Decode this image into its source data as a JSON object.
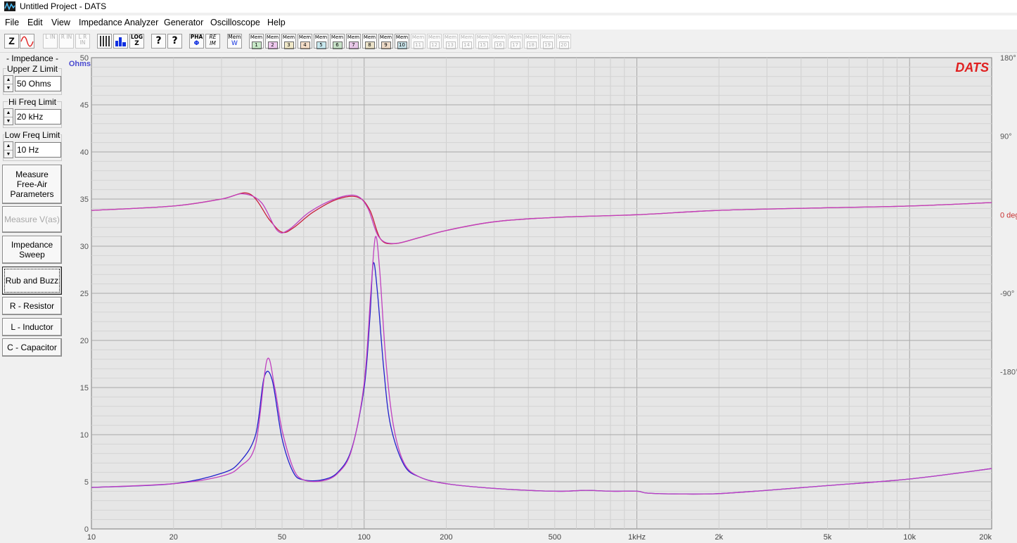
{
  "window": {
    "title": "Untitled Project - DATS"
  },
  "menu": [
    "File",
    "Edit",
    "View",
    "Impedance Analyzer",
    "Generator",
    "Oscilloscope",
    "Help"
  ],
  "toolbar": {
    "z_button": "Z",
    "wave_button": "sine-wave-icon",
    "l_in": "L IN",
    "r_in": "R IN",
    "lr_in": "L R IN",
    "log_button": "LOG",
    "log_sub": "Z",
    "help_button": "?",
    "context_help_button": "?",
    "pha_button": "PHA",
    "pha_sub": "Φ",
    "re_im_button": "RE",
    "re_im_sub": "IM",
    "mem_w_button": "Mem",
    "mem_w_sub": "W",
    "mem_label": "Mem",
    "mem_slots": [
      {
        "n": "1",
        "color": "#00a000",
        "enabled": true
      },
      {
        "n": "2",
        "color": "#c000c0",
        "enabled": true
      },
      {
        "n": "3",
        "color": "#c8a000",
        "enabled": true
      },
      {
        "n": "4",
        "color": "#e07000",
        "enabled": true
      },
      {
        "n": "5",
        "color": "#00a0c0",
        "enabled": true
      },
      {
        "n": "6",
        "color": "#008000",
        "enabled": true
      },
      {
        "n": "7",
        "color": "#a000a0",
        "enabled": true
      },
      {
        "n": "8",
        "color": "#b08000",
        "enabled": true
      },
      {
        "n": "9",
        "color": "#c06000",
        "enabled": true
      },
      {
        "n": "10",
        "color": "#0080a0",
        "enabled": true
      },
      {
        "n": "11",
        "color": "#b0b0b0",
        "enabled": false
      },
      {
        "n": "12",
        "color": "#b0b0b0",
        "enabled": false
      },
      {
        "n": "13",
        "color": "#b0b0b0",
        "enabled": false
      },
      {
        "n": "14",
        "color": "#b0b0b0",
        "enabled": false
      },
      {
        "n": "15",
        "color": "#b0b0b0",
        "enabled": false
      },
      {
        "n": "16",
        "color": "#b0b0b0",
        "enabled": false
      },
      {
        "n": "17",
        "color": "#b0b0b0",
        "enabled": false
      },
      {
        "n": "18",
        "color": "#b0b0b0",
        "enabled": false
      },
      {
        "n": "19",
        "color": "#b0b0b0",
        "enabled": false
      },
      {
        "n": "20",
        "color": "#b0b0b0",
        "enabled": false
      }
    ]
  },
  "panel": {
    "section_title": "- Impedance -",
    "upper_z": {
      "label": "Upper Z Limit",
      "value": "50 Ohms"
    },
    "hi_freq": {
      "label": "Hi Freq Limit",
      "value": "20 kHz"
    },
    "low_freq": {
      "label": "Low Freq Limit",
      "value": "10 Hz"
    },
    "buttons": {
      "free_air": "Measure Free-Air Parameters",
      "vas": "Measure V(as)",
      "sweep": "Impedance Sweep",
      "rub": "Rub and Buzz",
      "resistor": "R - Resistor",
      "inductor": "L - Inductor",
      "capacitor": "C - Capacitor"
    }
  },
  "chart_data": {
    "type": "line",
    "brand": "DATS",
    "ylabel": "Ohms",
    "x_scale": "log",
    "xlim": [
      10,
      20000
    ],
    "ylim": [
      0,
      50
    ],
    "y2lim": [
      -360,
      180
    ],
    "x_ticks": [
      {
        "v": 10,
        "label": "10"
      },
      {
        "v": 20,
        "label": "20"
      },
      {
        "v": 50,
        "label": "50"
      },
      {
        "v": 100,
        "label": "100"
      },
      {
        "v": 200,
        "label": "200"
      },
      {
        "v": 500,
        "label": "500"
      },
      {
        "v": 1000,
        "label": "1kHz"
      },
      {
        "v": 2000,
        "label": "2k"
      },
      {
        "v": 5000,
        "label": "5k"
      },
      {
        "v": 10000,
        "label": "10k"
      },
      {
        "v": 20000,
        "label": "20k"
      }
    ],
    "y_ticks": [
      0,
      5,
      10,
      15,
      20,
      25,
      30,
      35,
      40,
      45,
      50
    ],
    "y2_ticks": [
      {
        "v": 180,
        "label": "180°"
      },
      {
        "v": 90,
        "label": "90°"
      },
      {
        "v": 0,
        "label": "0 deg"
      },
      {
        "v": -90,
        "label": "-90°"
      },
      {
        "v": -180,
        "label": "-180°"
      }
    ],
    "grid": true,
    "series": [
      {
        "axis": "impedance",
        "color": "#2020cc",
        "x": [
          10,
          20,
          30,
          35,
          40,
          43,
          46,
          50,
          55,
          60,
          70,
          80,
          90,
          100,
          105,
          108,
          112,
          118,
          125,
          140,
          160,
          200,
          300,
          500,
          650,
          800,
          1000,
          1100,
          1500,
          2000,
          3000,
          5000,
          10000,
          20000
        ],
        "y": [
          4.4,
          4.8,
          5.9,
          7.1,
          10.0,
          16.1,
          15.8,
          9.6,
          6.0,
          5.2,
          5.2,
          6.0,
          8.5,
          15.0,
          22.5,
          28.2,
          25.0,
          17.0,
          11.0,
          6.8,
          5.5,
          4.8,
          4.3,
          4.0,
          4.1,
          4.0,
          4.0,
          3.8,
          3.7,
          3.75,
          4.1,
          4.6,
          5.3,
          6.4
        ]
      },
      {
        "axis": "impedance",
        "color": "#c040c0",
        "x": [
          10,
          20,
          30,
          35,
          40,
          44,
          47,
          50,
          55,
          60,
          70,
          80,
          90,
          100,
          106,
          110,
          114,
          120,
          128,
          140,
          160,
          200,
          300,
          500,
          650,
          800,
          1000,
          1100,
          1500,
          2000,
          3000,
          5000,
          10000,
          20000
        ],
        "y": [
          4.4,
          4.8,
          5.6,
          6.6,
          9.0,
          17.9,
          15.0,
          10.5,
          6.4,
          5.2,
          5.1,
          5.9,
          8.4,
          15.5,
          25.5,
          31.0,
          27.5,
          18.0,
          11.0,
          7.0,
          5.5,
          4.8,
          4.3,
          4.0,
          4.1,
          4.0,
          4.0,
          3.8,
          3.7,
          3.75,
          4.1,
          4.6,
          5.3,
          6.4
        ]
      },
      {
        "axis": "phase",
        "color": "#c81e3c",
        "x": [
          10,
          20,
          30,
          38,
          45,
          50,
          55,
          65,
          80,
          95,
          105,
          115,
          130,
          160,
          200,
          300,
          500,
          1000,
          2000,
          5000,
          10000,
          20000
        ],
        "y": [
          5,
          10,
          18,
          24,
          -6,
          -20,
          -15,
          3,
          18,
          20,
          5,
          -28,
          -33,
          -26,
          -18,
          -8,
          -3,
          0,
          5,
          8,
          10,
          14
        ]
      },
      {
        "axis": "phase",
        "color": "#c040c0",
        "x": [
          10,
          20,
          30,
          36,
          42,
          48,
          53,
          63,
          78,
          93,
          103,
          113,
          128,
          160,
          200,
          300,
          500,
          1000,
          2000,
          5000,
          10000,
          20000
        ],
        "y": [
          5,
          10,
          18,
          24,
          14,
          -18,
          -17,
          3,
          18,
          22,
          8,
          -25,
          -33,
          -26,
          -18,
          -8,
          -3,
          0,
          5,
          8,
          10,
          14
        ]
      }
    ]
  }
}
